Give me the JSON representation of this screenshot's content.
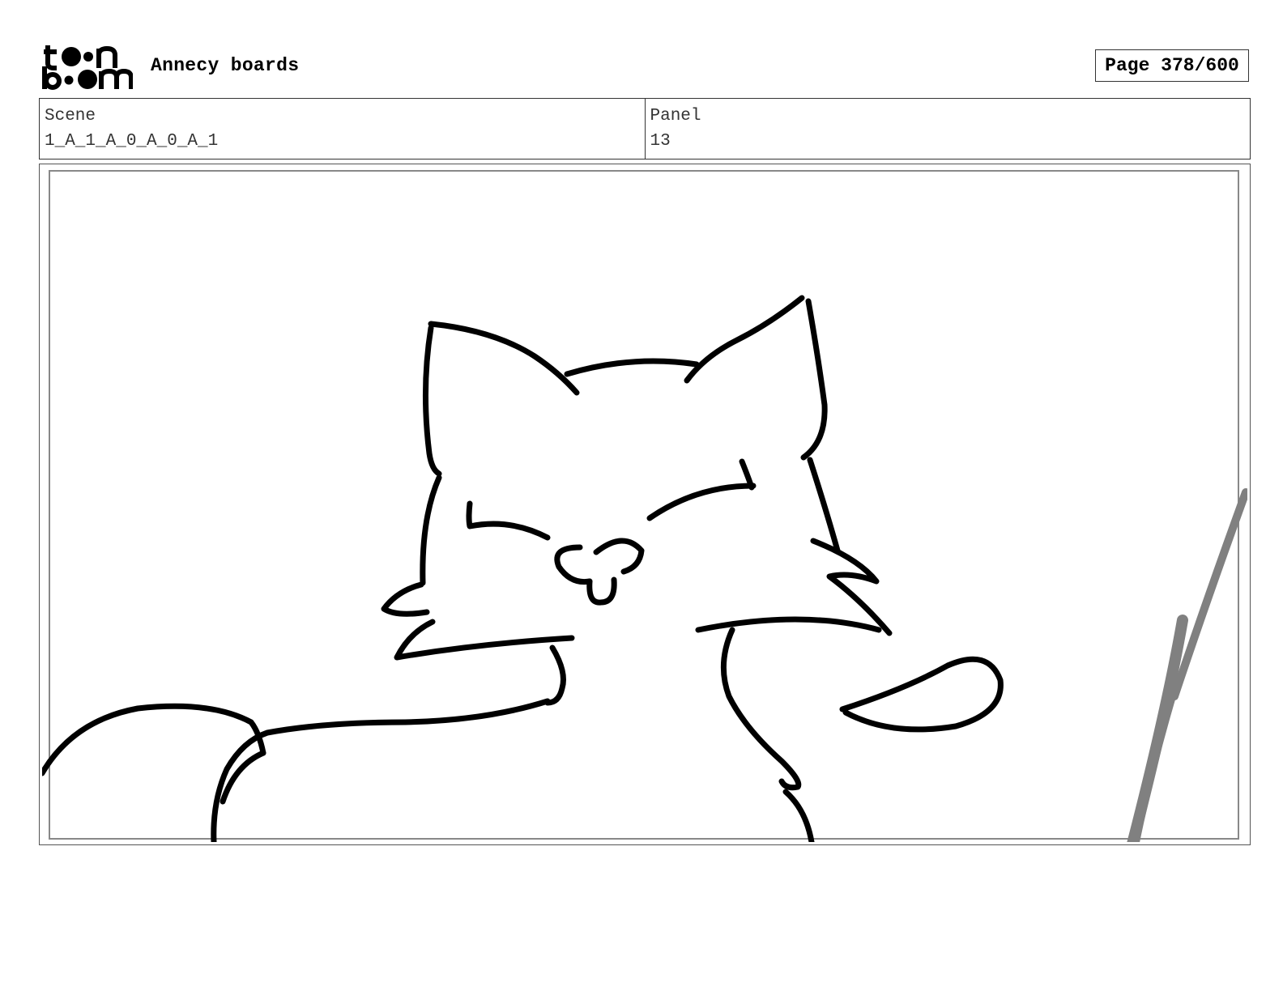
{
  "header": {
    "logo": {
      "name": "toon-boom-logo",
      "line1": "toon",
      "line2": "boom"
    },
    "project_title": "Annecy boards",
    "page_label": "Page 378/600"
  },
  "info": {
    "scene_label": "Scene",
    "scene_value": "1_A_1_A_0_A_0_A_1",
    "panel_label": "Panel",
    "panel_value": "13"
  },
  "panel": {
    "image_description_icon": "cat-sketch",
    "stroke_color": "#000000",
    "accent_stroke_color": "#808080"
  }
}
